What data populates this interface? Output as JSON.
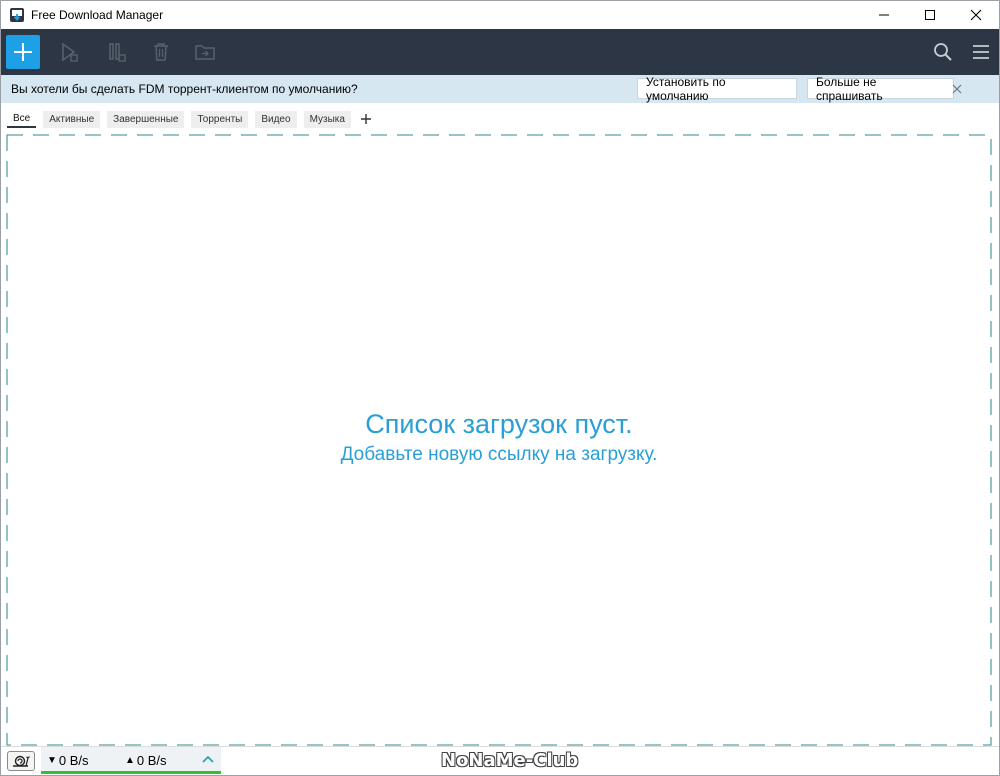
{
  "window": {
    "title": "Free Download Manager"
  },
  "toolbar": {
    "buttons": [
      {
        "name": "add",
        "icon": "plus-icon"
      },
      {
        "name": "start",
        "icon": "play-icon"
      },
      {
        "name": "pause",
        "icon": "pause-icon"
      },
      {
        "name": "delete",
        "icon": "trash-icon"
      },
      {
        "name": "move",
        "icon": "folder-icon"
      },
      {
        "name": "search",
        "icon": "search-icon"
      },
      {
        "name": "menu",
        "icon": "hamburger-icon"
      }
    ]
  },
  "notification": {
    "text": "Вы хотели бы сделать FDM торрент-клиентом по умолчанию?",
    "set_default_label": "Установить по умолчанию",
    "dont_ask_label": "Больше не спрашивать"
  },
  "tabs": [
    {
      "label": "Все",
      "active": true
    },
    {
      "label": "Активные",
      "active": false
    },
    {
      "label": "Завершенные",
      "active": false
    },
    {
      "label": "Торренты",
      "active": false
    },
    {
      "label": "Видео",
      "active": false
    },
    {
      "label": "Музыка",
      "active": false
    }
  ],
  "empty_state": {
    "title": "Список загрузок пуст.",
    "subtitle": "Добавьте новую ссылку на загрузку."
  },
  "status": {
    "download_speed": "0 B/s",
    "upload_speed": "0 B/s",
    "watermark": "NoNaMe-Club"
  },
  "colors": {
    "toolbar_bg": "#2d3645",
    "accent": "#1ea0e6",
    "notify_bg": "#d6e7f2",
    "empty_text": "#2a9fd6",
    "dash_border": "#5aa0a4",
    "speed_bar": "#31c131"
  }
}
